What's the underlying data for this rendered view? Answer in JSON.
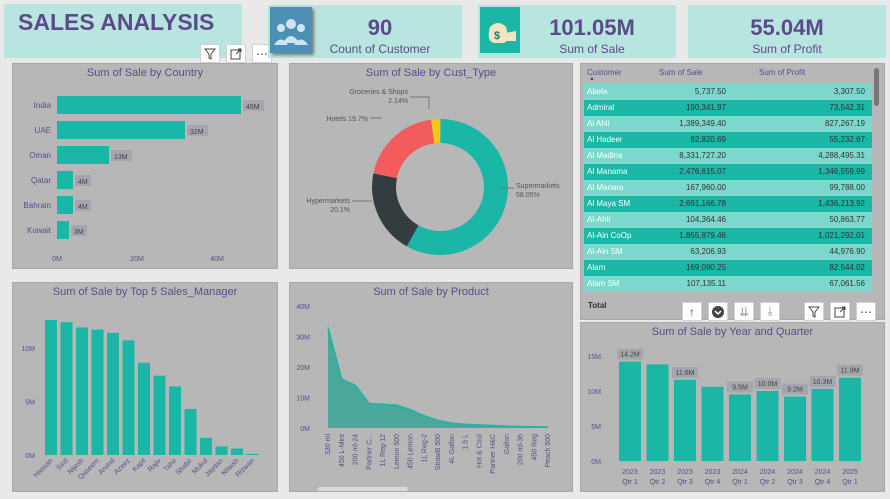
{
  "header": {
    "title": "SALES ANALYSIS"
  },
  "kpis": [
    {
      "value": "90",
      "label": "Count of Customer",
      "icon": "people-icon"
    },
    {
      "value": "101.05M",
      "label": "Sum of Sale",
      "icon": "money-bag-icon"
    },
    {
      "value": "55.04M",
      "label": "Sum of Profit",
      "icon": ""
    }
  ],
  "colors": {
    "accent": "#1ab6a6",
    "title": "#5b4b8a",
    "panel": "#b7b7b7",
    "kpi_bg": "#b9e5e0"
  },
  "titles": {
    "country": "Sum of Sale by Country",
    "custtype": "Sum of Sale by Cust_Type",
    "manager": "Sum of Sale by Top 5 Sales_Manager",
    "product": "Sum of Sale by Product",
    "yearq": "Sum of Sale by Year and Quarter"
  },
  "table": {
    "headers": [
      "Customer",
      "Sum of Sale",
      "Sum of Profit"
    ],
    "rows": [
      [
        "Abela",
        "5,737.50",
        "3,307.50"
      ],
      [
        "Admiral",
        "190,341.97",
        "73,542.31"
      ],
      [
        "Al Ahli",
        "1,389,349.40",
        "827,267.19"
      ],
      [
        "Al Hadeer",
        "92,820.69",
        "55,232.67"
      ],
      [
        "Al Madina",
        "8,331,727.20",
        "4,288,495.31"
      ],
      [
        "Al Manama",
        "2,476,615.07",
        "1,346,559.99"
      ],
      [
        "Al Manara",
        "167,960.00",
        "99,788.00"
      ],
      [
        "Al Maya SM",
        "2,691,166.78",
        "1,436,213.92"
      ],
      [
        "Al-Ahli",
        "104,364.46",
        "50,863.77"
      ],
      [
        "Al-Ain CoOp",
        "1,855,879.46",
        "1,021,292.01"
      ],
      [
        "Al-Ain SM",
        "63,206.93",
        "44,976.90"
      ],
      [
        "Alam",
        "169,090.25",
        "82,544.02"
      ],
      [
        "Alam SM",
        "107,135.11",
        "67,061.56"
      ]
    ],
    "total_label": "Total"
  },
  "chart_data": [
    {
      "type": "bar",
      "title": "Sum of Sale by Country",
      "categories": [
        "India",
        "UAE",
        "Oman",
        "Qatar",
        "Bahrain",
        "Kuwait"
      ],
      "values": [
        46,
        32,
        13,
        4,
        4,
        3
      ],
      "data_labels": [
        "46M",
        "32M",
        "13M",
        "4M",
        "4M",
        "3M"
      ],
      "x_ticks": [
        "0M",
        "20M",
        "40M"
      ],
      "xlim": [
        0,
        50
      ]
    },
    {
      "type": "pie",
      "title": "Sum of Sale by Cust_Type",
      "slices": [
        {
          "name": "Supermarkets",
          "pct": 58.05,
          "label": "Supermarkets\n58.05%",
          "color": "#1ab6a6"
        },
        {
          "name": "Hypermarkets",
          "pct": 20.1,
          "label": "Hypermarkets\n20.1%",
          "color": "#333d3f"
        },
        {
          "name": "Hotels",
          "pct": 19.7,
          "label": "Hotels 19.7%",
          "color": "#f25c5c"
        },
        {
          "name": "Groceries & Shops",
          "pct": 2.14,
          "label": "Groceries & Shops\n2.14%",
          "color": "#f2c811"
        }
      ]
    },
    {
      "type": "bar",
      "title": "Sum of Sale by Top 5 Sales_Manager",
      "categories": [
        "Hassan",
        "Sinil",
        "Nijesh",
        "Qaseem",
        "Arvind",
        "Azeez",
        "Kapil",
        "Rajiv",
        "Tahir",
        "Shabir",
        "Mukul",
        "Jaydan",
        "Nilaish",
        "Rizwan"
      ],
      "values": [
        12.6,
        12.4,
        11.9,
        11.7,
        11.4,
        10.7,
        8.6,
        7.4,
        6.4,
        4.3,
        1.6,
        0.8,
        0.6,
        0.1
      ],
      "y_ticks": [
        "0M",
        "5M",
        "10M"
      ],
      "ylim": [
        0,
        14
      ]
    },
    {
      "type": "area",
      "title": "Sum of Sale by Product",
      "categories": [
        "330 ml",
        "450 L-Mint",
        "200 ml-24",
        "Partner C...",
        "1L Reg-12",
        "Lemon 500",
        "450 Lemon",
        "1L Reg-2",
        "StrawB 500",
        "4L Gallon",
        "1.5 L",
        "Hot & Cool",
        "Partner H&C",
        "Gallon",
        "200 ml-36",
        "450 Reg",
        "Peach 500"
      ],
      "values": [
        33,
        16,
        14,
        8,
        7.8,
        7.5,
        6,
        4,
        2.5,
        1.6,
        1.2,
        1,
        0.8,
        0.6,
        0.5,
        0.4,
        0.3
      ],
      "y_ticks": [
        "0M",
        "10M",
        "20M",
        "30M",
        "40M"
      ],
      "ylim": [
        0,
        40
      ]
    },
    {
      "type": "bar",
      "title": "Sum of Sale by Year and Quarter",
      "categories": [
        "2023 Qtr 1",
        "2023 Qtr 2",
        "2023 Qtr 3",
        "2023 Qtr 4",
        "2024 Qtr 1",
        "2024 Qtr 2",
        "2024 Qtr 3",
        "2024 Qtr 4",
        "2025 Qtr 1"
      ],
      "values": [
        14.2,
        13.8,
        11.6,
        10.6,
        9.5,
        10.0,
        9.2,
        10.3,
        11.9
      ],
      "data_labels": [
        "14.2M",
        "",
        "11.6M",
        "",
        "9.5M",
        "10.0M",
        "9.2M",
        "10.3M",
        "11.9M"
      ],
      "y_ticks": [
        "0M",
        "5M",
        "10M",
        "15M"
      ],
      "ylim": [
        0,
        16
      ]
    }
  ]
}
